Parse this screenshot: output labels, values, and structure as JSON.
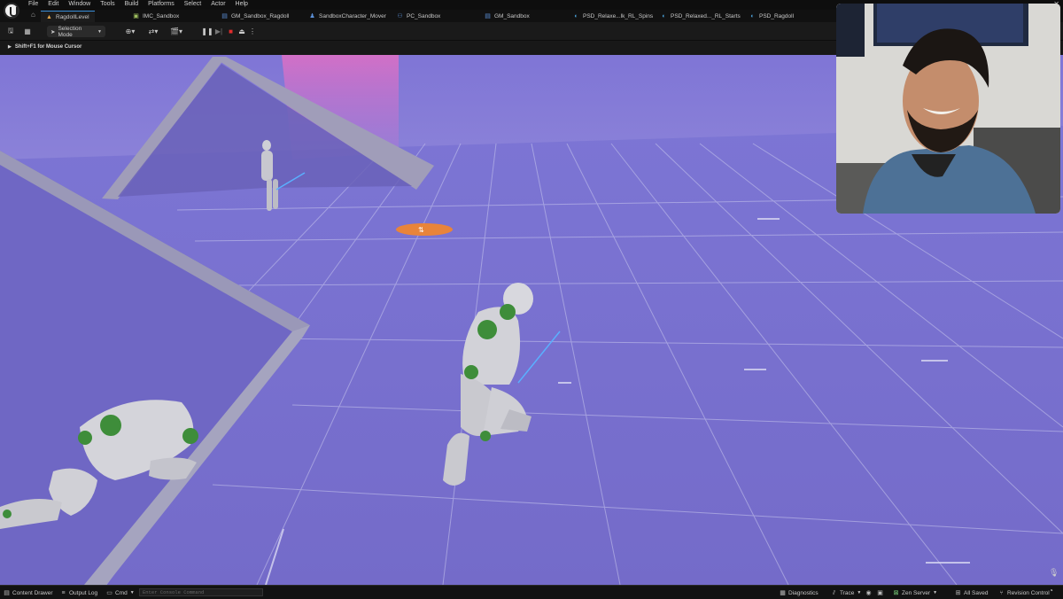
{
  "menu": [
    "File",
    "Edit",
    "Window",
    "Tools",
    "Build",
    "Platforms",
    "Select",
    "Actor",
    "Help"
  ],
  "tabs": [
    {
      "label": "RagdollLevel",
      "icon": "level-icon",
      "active": true
    },
    {
      "label": "IMC_Sandbox",
      "icon": "input-mapping-icon"
    },
    {
      "label": "GM_Sandbox_Ragdoll",
      "icon": "blueprint-icon"
    },
    {
      "label": "SandboxCharacter_Mover",
      "icon": "character-icon"
    },
    {
      "label": "PC_Sandbox",
      "icon": "controller-icon"
    },
    {
      "label": "GM_Sandbox",
      "icon": "blueprint-icon"
    },
    {
      "label": "PSD_Relaxe...lk_RL_Spins",
      "icon": "pose-search-icon"
    },
    {
      "label": "PSD_Relaxed..._RL_Starts",
      "icon": "pose-search-icon"
    },
    {
      "label": "PSD_Ragdoll",
      "icon": "pose-search-icon"
    }
  ],
  "toolbar": {
    "selection_mode": "Selection Mode"
  },
  "viewport": {
    "hint": "Shift+F1 for Mouse Cursor"
  },
  "statusbar": {
    "content_drawer": "Content Drawer",
    "output_log": "Output Log",
    "cmd": "Cmd",
    "console_placeholder": "Enter Console Command",
    "diagnostics": "Diagnostics",
    "trace": "Trace",
    "zen_server": "Zen Server",
    "all_saved": "All Saved",
    "revision_control": "Revision Control"
  },
  "colors": {
    "floor": "#7b74cf",
    "grid": "#cfd0f0",
    "accent_green": "#3e8d3a",
    "marker_orange": "#e8843a",
    "stop_red": "#e02d2d"
  }
}
